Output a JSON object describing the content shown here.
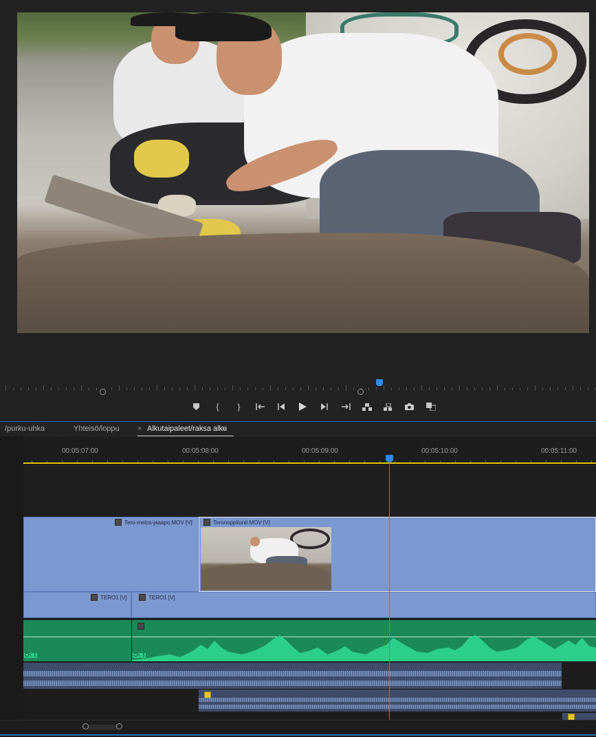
{
  "monitor": {
    "transport": [
      {
        "name": "add-marker-button",
        "glyph": "▼"
      },
      {
        "name": "mark-in-button",
        "glyph": "{"
      },
      {
        "name": "mark-out-button",
        "glyph": "}"
      },
      {
        "name": "go-to-in-button",
        "glyph": "{←"
      },
      {
        "name": "step-back-button",
        "glyph": "◀"
      },
      {
        "name": "play-button",
        "glyph": "▶"
      },
      {
        "name": "step-forward-button",
        "glyph": "▶"
      },
      {
        "name": "go-to-out-button",
        "glyph": "→}"
      },
      {
        "name": "lift-button",
        "glyph": ""
      },
      {
        "name": "extract-button",
        "glyph": ""
      },
      {
        "name": "export-frame-button",
        "glyph": ""
      },
      {
        "name": "compare-view-button",
        "glyph": ""
      }
    ]
  },
  "tabs": [
    {
      "label": "/purku-uhka",
      "active": false
    },
    {
      "label": "Yhteisö/loppu",
      "active": false
    },
    {
      "close": "×",
      "label": "Alkutaipaleet/raksa alku",
      "menu": "≡",
      "active": true
    }
  ],
  "timeline": {
    "timecodes": [
      "00:05:07:00",
      "00:05:08:00",
      "00:05:09:00",
      "00:05:10:00",
      "00:05:11:00"
    ],
    "video_clips": [
      {
        "label": "Tero-melos-jaaapo.MOV [V]"
      },
      {
        "label": "Teronoppitunti.MOV [V]"
      },
      {
        "label": "TERO1 [V]"
      },
      {
        "label": "TERO1 [V]"
      }
    ],
    "audio_channel_label": "Ch. 1",
    "colors": {
      "video_clip": "#7b98d1",
      "audio_clip": "#1c8a58",
      "waveform": "#2bcf8a",
      "playhead": "#2d8ceb",
      "work_area": "#e6c200"
    }
  }
}
